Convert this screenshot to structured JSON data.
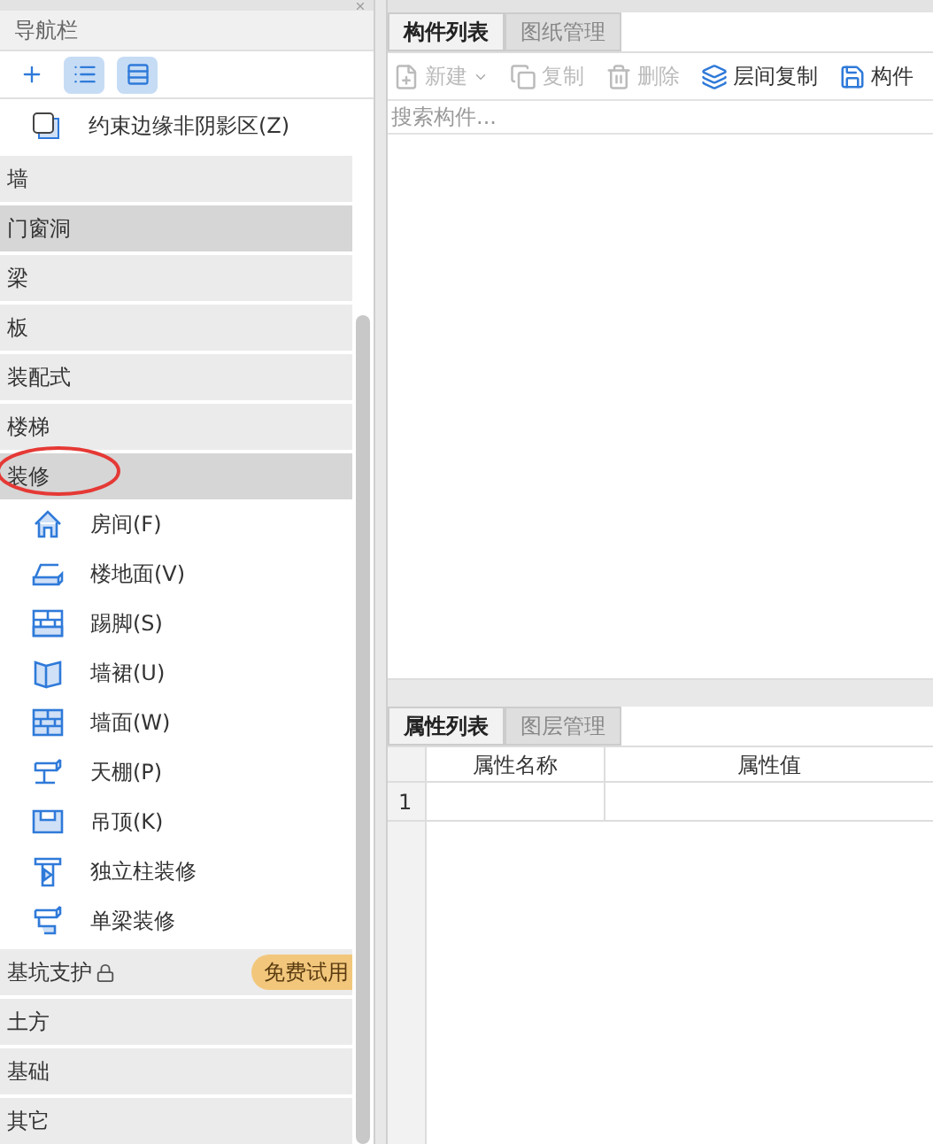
{
  "nav": {
    "title": "导航栏",
    "toolbar": [
      {
        "selected": false
      },
      {
        "selected": true
      },
      {
        "selected": true
      }
    ],
    "top_item": "约束边缘非阴影区(Z)",
    "categories": [
      {
        "label": "墙",
        "highlighted": false
      },
      {
        "label": "门窗洞",
        "highlighted": true
      },
      {
        "label": "梁",
        "highlighted": false
      },
      {
        "label": "板",
        "highlighted": false
      },
      {
        "label": "装配式",
        "highlighted": false
      },
      {
        "label": "楼梯",
        "highlighted": false
      },
      {
        "label": "装修",
        "highlighted": true,
        "expanded": true,
        "children": [
          "房间(F)",
          "楼地面(V)",
          "踢脚(S)",
          "墙裙(U)",
          "墙面(W)",
          "天棚(P)",
          "吊顶(K)",
          "独立柱装修",
          "单梁装修"
        ]
      },
      {
        "label": "基坑支护",
        "highlighted": false,
        "locked": true,
        "badge": "免费试用"
      },
      {
        "label": "土方",
        "highlighted": false
      },
      {
        "label": "基础",
        "highlighted": false
      },
      {
        "label": "其它",
        "highlighted": false
      }
    ]
  },
  "component_panel": {
    "tabs": [
      {
        "label": "构件列表",
        "selected": true
      },
      {
        "label": "图纸管理",
        "selected": false
      }
    ],
    "toolbar": [
      {
        "label": "新建",
        "disabled": true,
        "dropdown": true
      },
      {
        "label": "复制",
        "disabled": true,
        "dropdown": false
      },
      {
        "label": "删除",
        "disabled": true,
        "dropdown": false
      },
      {
        "label": "层间复制",
        "disabled": false,
        "dropdown": false
      },
      {
        "label": "构件",
        "disabled": false,
        "dropdown": false
      }
    ],
    "search": {
      "placeholder": "搜索构件..."
    }
  },
  "property_panel": {
    "tabs": [
      {
        "label": "属性列表",
        "selected": true
      },
      {
        "label": "图层管理",
        "selected": false
      }
    ],
    "columns": [
      "属性名称",
      "属性值"
    ],
    "rows": [
      {
        "number": "1"
      }
    ]
  }
}
